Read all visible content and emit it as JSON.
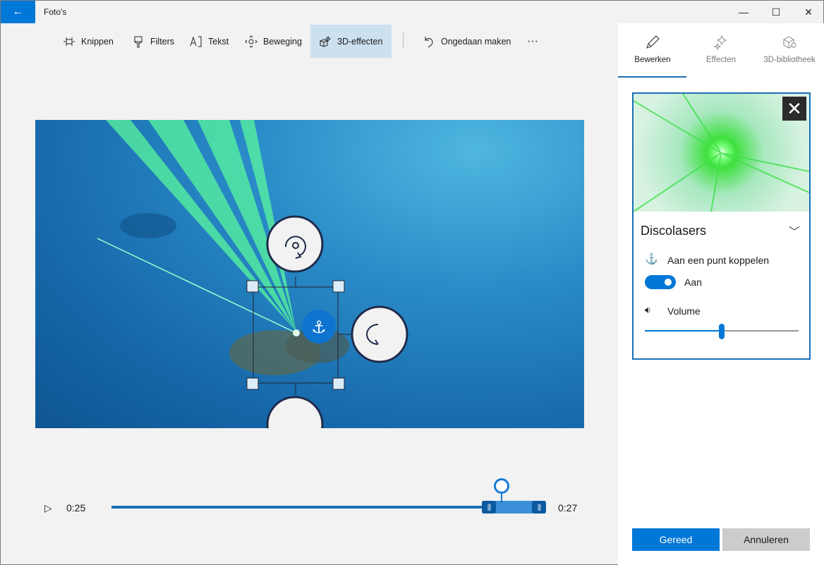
{
  "app": {
    "title": "Foto's"
  },
  "window": {
    "back": "back-icon",
    "minimize": "—",
    "maximize": "☐",
    "close": "✕"
  },
  "toolbar": {
    "items": [
      {
        "label": "Knippen",
        "icon": "trim-icon"
      },
      {
        "label": "Filters",
        "icon": "brush-icon"
      },
      {
        "label": "Tekst",
        "icon": "text-icon"
      },
      {
        "label": "Beweging",
        "icon": "motion-icon"
      },
      {
        "label": "3D-effecten",
        "icon": "3d-effects-icon",
        "active": true
      }
    ],
    "undo": "Ongedaan maken",
    "more": "···"
  },
  "panel": {
    "tabs": [
      {
        "label": "Bewerken",
        "selected": true
      },
      {
        "label": "Effecten"
      },
      {
        "label": "3D-bibliotheek"
      }
    ],
    "effect": {
      "name": "Discolasers",
      "anchor_label": "Aan een punt koppelen",
      "toggle_state": "Aan",
      "toggle_on": true,
      "volume_label": "Volume",
      "volume_percent": 50,
      "close": "✕",
      "chevron": "﹀"
    },
    "done": "Gereed",
    "cancel": "Annuleren"
  },
  "timeline": {
    "start": "0:25",
    "end": "0:27",
    "play": "▷",
    "position_fraction": 0.9,
    "grip": "|||"
  },
  "colors": {
    "accent": "#0078d7",
    "active_tab": "#cce0f0"
  }
}
